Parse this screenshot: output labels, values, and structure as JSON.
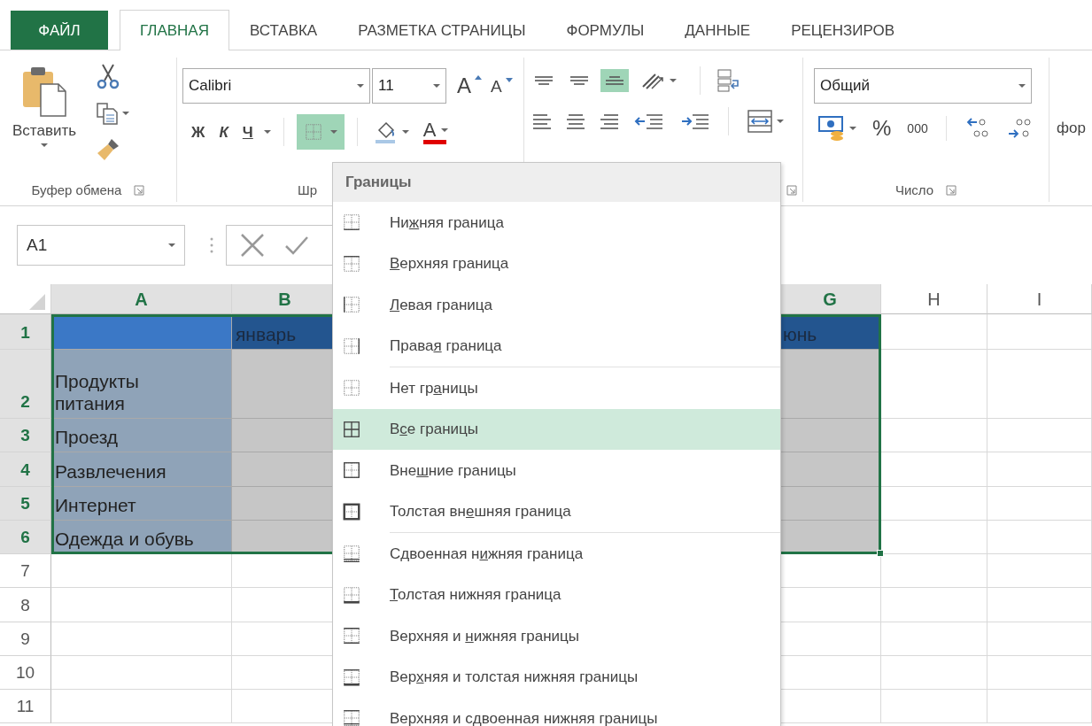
{
  "tabs": [
    {
      "label": "ФАЙЛ",
      "kind": "file",
      "selected": false
    },
    {
      "label": "ГЛАВНАЯ",
      "kind": "tab",
      "selected": true
    },
    {
      "label": "ВСТАВКА",
      "kind": "tab",
      "selected": false
    },
    {
      "label": "РАЗМЕТКА СТРАНИЦЫ",
      "kind": "tab",
      "selected": false
    },
    {
      "label": "ФОРМУЛЫ",
      "kind": "tab",
      "selected": false
    },
    {
      "label": "ДАННЫЕ",
      "kind": "tab",
      "selected": false
    },
    {
      "label": "РЕЦЕНЗИРОВ",
      "kind": "tab",
      "selected": false
    }
  ],
  "clipboard": {
    "paste_label": "Вставить",
    "group_label": "Буфер обмена"
  },
  "font": {
    "font_name": "Calibri",
    "font_size": "11",
    "grow": "A",
    "shrink": "A",
    "bold": "Ж",
    "italic": "К",
    "underline": "Ч",
    "borders_open": true,
    "font_color": "A",
    "group_label": "Шр"
  },
  "alignment": {
    "vertical": [
      {
        "kind": "top",
        "selected": false
      },
      {
        "kind": "middle",
        "selected": false
      },
      {
        "kind": "bottom",
        "selected": true
      }
    ]
  },
  "number": {
    "format": "Общий",
    "percent": "%",
    "thousands": "000",
    "group_label": "Число"
  },
  "styles": {
    "label": "фор"
  },
  "formula_bar": {
    "name_box": "A1"
  },
  "sheet": {
    "columns": [
      {
        "label": "A",
        "kind": "label",
        "selected": true
      },
      {
        "label": "B",
        "kind": "value",
        "selected": true
      },
      {
        "label": "G",
        "kind": "value",
        "selected": true
      },
      {
        "label": "H",
        "kind": "value",
        "selected": false
      },
      {
        "label": "I",
        "kind": "value",
        "selected": false
      }
    ],
    "rows": [
      {
        "label": "1",
        "kind": "header",
        "selected": true,
        "cells": [
          {},
          {
            "text": "январь"
          },
          {
            "text": "юнь"
          },
          {},
          {}
        ]
      },
      {
        "label": "2",
        "kind": "tall",
        "selected": true,
        "cells": [
          {
            "text": "Продукты\nпитания"
          },
          {},
          {},
          {},
          {}
        ]
      },
      {
        "label": "3",
        "kind": "data",
        "selected": true,
        "cells": [
          {
            "text": "Проезд"
          },
          {},
          {},
          {},
          {}
        ]
      },
      {
        "label": "4",
        "kind": "data",
        "selected": true,
        "cells": [
          {
            "text": "Развлечения"
          },
          {},
          {},
          {},
          {}
        ]
      },
      {
        "label": "5",
        "kind": "data",
        "selected": true,
        "cells": [
          {
            "text": "Интернет"
          },
          {},
          {},
          {},
          {}
        ]
      },
      {
        "label": "6",
        "kind": "data",
        "selected": true,
        "cells": [
          {
            "text": "Одежда и обувь"
          },
          {},
          {},
          {},
          {}
        ]
      },
      {
        "label": "7",
        "kind": "data",
        "selected": false,
        "cells": [
          {},
          {},
          {},
          {},
          {}
        ]
      },
      {
        "label": "8",
        "kind": "data",
        "selected": false,
        "cells": [
          {},
          {},
          {},
          {},
          {}
        ]
      },
      {
        "label": "9",
        "kind": "data",
        "selected": false,
        "cells": [
          {},
          {},
          {},
          {},
          {}
        ]
      },
      {
        "label": "10",
        "kind": "data",
        "selected": false,
        "cells": [
          {},
          {},
          {},
          {},
          {}
        ]
      },
      {
        "label": "11",
        "kind": "data",
        "selected": false,
        "cells": [
          {},
          {},
          {},
          {},
          {}
        ]
      }
    ]
  },
  "borders_menu": {
    "title": "Границы",
    "items": [
      {
        "kind": "bottom",
        "before": "Ни",
        "key": "ж",
        "after": "няя граница",
        "divider_above": false,
        "selected": false
      },
      {
        "kind": "top",
        "key": "В",
        "after": "ерхняя граница",
        "divider_above": false,
        "selected": false
      },
      {
        "kind": "left",
        "key": "Л",
        "after": "евая граница",
        "divider_above": false,
        "selected": false
      },
      {
        "kind": "right",
        "before": "Права",
        "key": "я",
        "after": " граница",
        "divider_above": false,
        "selected": false
      },
      {
        "kind": "none",
        "before": "Нет гр",
        "key": "а",
        "after": "ницы",
        "divider_above": true,
        "selected": false
      },
      {
        "kind": "all",
        "before": "В",
        "key": "с",
        "after": "е границы",
        "divider_above": false,
        "selected": true
      },
      {
        "kind": "outside",
        "before": "Вне",
        "key": "ш",
        "after": "ние границы",
        "divider_above": false,
        "selected": false
      },
      {
        "kind": "thick-outside",
        "before": "Толстая вн",
        "key": "е",
        "after": "шняя граница",
        "divider_above": false,
        "selected": false
      },
      {
        "kind": "double-bottom",
        "before": "Сдвоенная н",
        "key": "и",
        "after": "жняя граница",
        "divider_above": true,
        "selected": false
      },
      {
        "kind": "thick-bottom",
        "key": "Т",
        "after": "олстая нижняя граница",
        "divider_above": false,
        "selected": false
      },
      {
        "kind": "top-bottom",
        "before": "Верхняя и ",
        "key": "н",
        "after": "ижняя границы",
        "divider_above": false,
        "selected": false
      },
      {
        "kind": "top-thick-bottom",
        "before": "Вер",
        "key": "х",
        "after": "няя и толстая нижняя границы",
        "divider_above": false,
        "selected": false
      },
      {
        "kind": "top-double-bottom",
        "before": "Верхняя и сдвоенная нижняя границы",
        "divider_above": false,
        "selected": false
      }
    ]
  }
}
